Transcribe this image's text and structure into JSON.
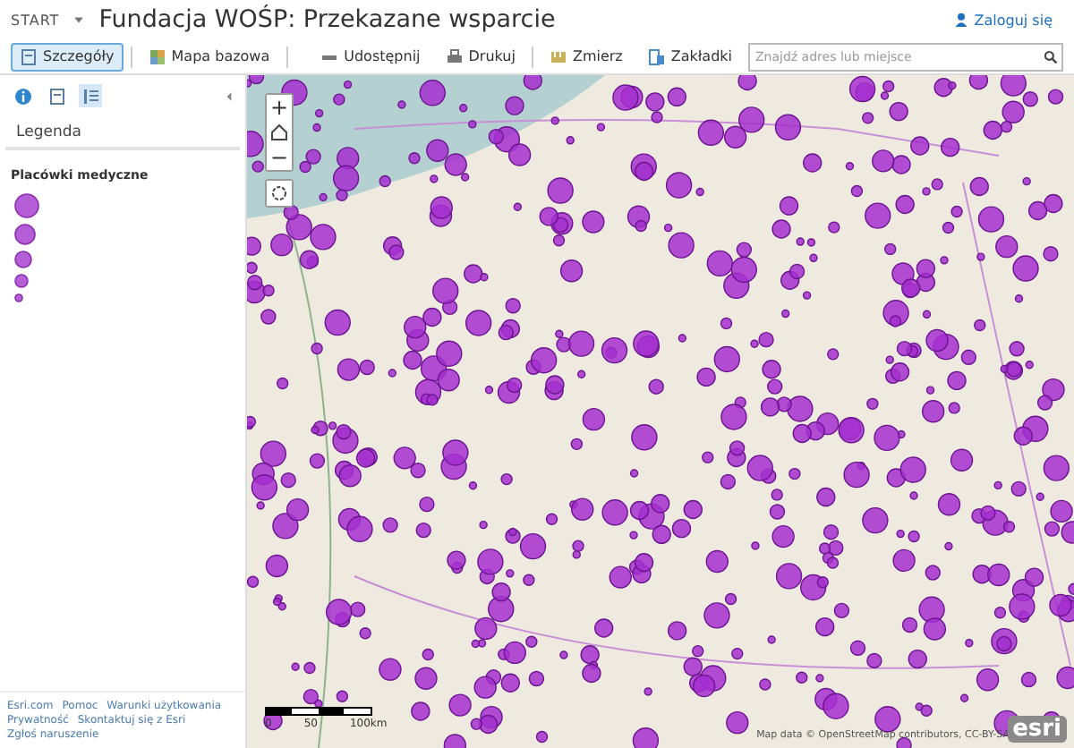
{
  "header": {
    "start_menu": "START",
    "title": "Fundacja WOŚP: Przekazane wsparcie",
    "sign_in": "Zaloguj się"
  },
  "toolbar": {
    "left": [
      {
        "kind": "details",
        "label": "Szczegóły",
        "selected": true
      },
      {
        "kind": "basemap",
        "label": "Mapa bazowa",
        "selected": false
      }
    ],
    "right": [
      {
        "kind": "share",
        "label": "Udostępnij"
      },
      {
        "kind": "print",
        "label": "Drukuj"
      },
      {
        "kind": "measure",
        "label": "Zmierz"
      },
      {
        "kind": "bookmarks",
        "label": "Zakładki"
      }
    ],
    "search": {
      "placeholder": "Znajdź adres lub miejsce"
    }
  },
  "panel": {
    "tabs": [
      {
        "kind": "about",
        "selected": false
      },
      {
        "kind": "content",
        "selected": false
      },
      {
        "kind": "legend",
        "selected": true
      }
    ],
    "heading": "Legenda",
    "layer": "Placówki medyczne",
    "footer_links": [
      "Esri.com",
      "Pomoc",
      "Warunki użytkowania",
      "Prywatność",
      "Skontaktuj się z Esri",
      "Zgłoś naruszenie"
    ]
  },
  "map": {
    "zoom_in": "+",
    "zoom_out": "−",
    "scale": [
      "0",
      "50",
      "100km"
    ],
    "attribution": "Map data © OpenStreetMap contributors, CC-BY-SA",
    "logo": "esri"
  }
}
